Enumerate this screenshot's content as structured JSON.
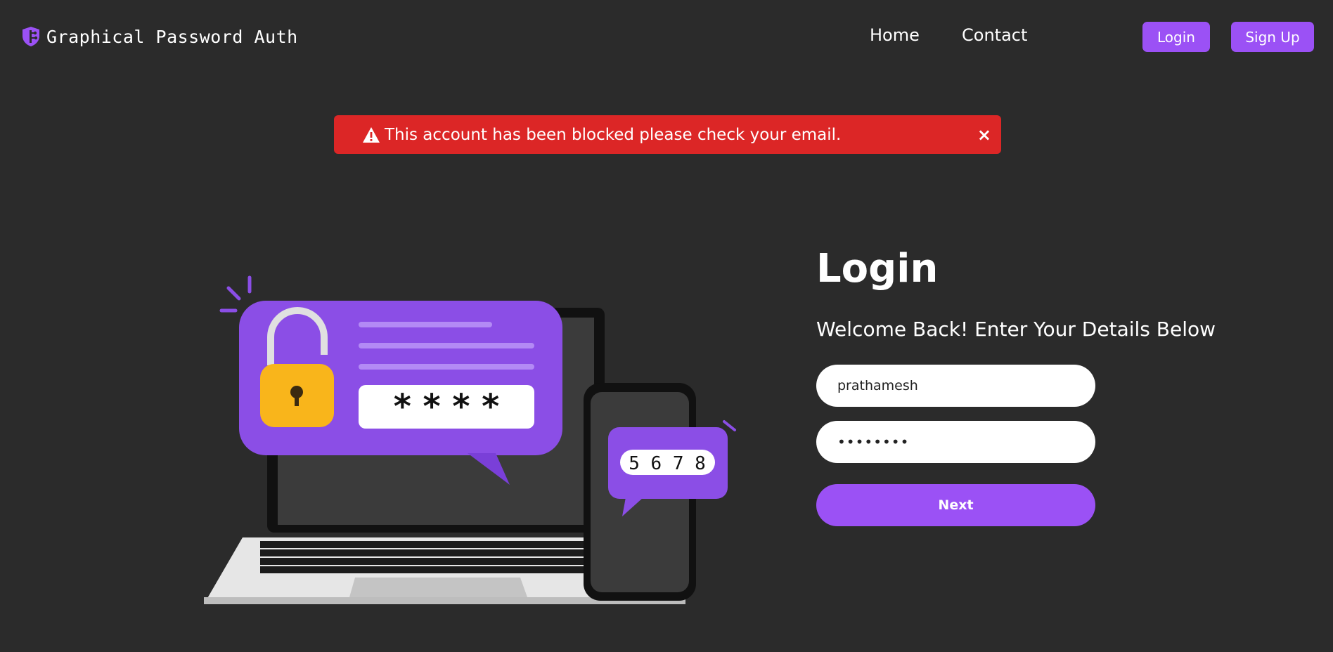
{
  "nav": {
    "brand": "Graphical Password Auth",
    "links": [
      "Home",
      "Contact"
    ],
    "login_button": "Login",
    "signup_button": "Sign Up"
  },
  "alert": {
    "message": "This account has been blocked please check your email.",
    "close_glyph": "×",
    "color": "#dc2626"
  },
  "illustration": {
    "password_mask": "* * * *",
    "phone_code": "5 6 7 8"
  },
  "form": {
    "title": "Login",
    "subtitle": "Welcome Back! Enter Your Details Below",
    "username_value": "prathamesh",
    "password_value": "••••••••",
    "next_button": "Next"
  },
  "colors": {
    "background": "#2b2b2b",
    "accent": "#9b51f5",
    "alert": "#dc2626",
    "lock": "#f9b51b"
  }
}
